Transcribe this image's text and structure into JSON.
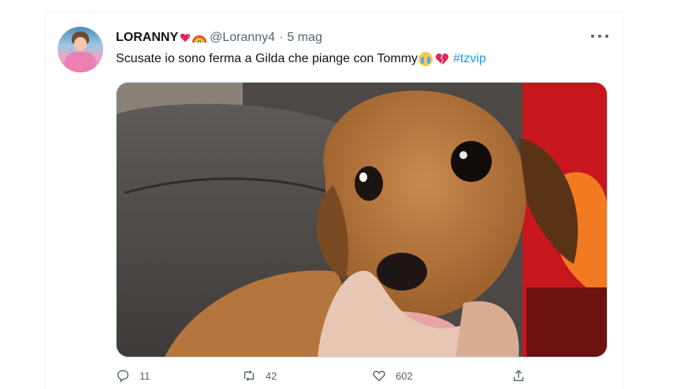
{
  "tweet": {
    "display_name": "LORANNY",
    "handle": "@Loranny4",
    "separator": "·",
    "date": "5 mag",
    "text": "Scusate io sono ferma a Gilda che piange con Tommy",
    "hashtag": "#tzvip",
    "emojis": [
      "heart-icon",
      "rainbow-icon",
      "crying-face-icon",
      "broken-heart-icon"
    ],
    "image_alt": "dog-photo"
  },
  "actions": {
    "reply": {
      "icon": "reply-icon",
      "count": "11"
    },
    "retweet": {
      "icon": "retweet-icon",
      "count": "42"
    },
    "like": {
      "icon": "like-icon",
      "count": "602"
    },
    "share": {
      "icon": "share-icon"
    }
  },
  "colors": {
    "text": "#0f1419",
    "secondary": "#536471",
    "link": "#1d9bf0",
    "border": "#cfd9de"
  }
}
